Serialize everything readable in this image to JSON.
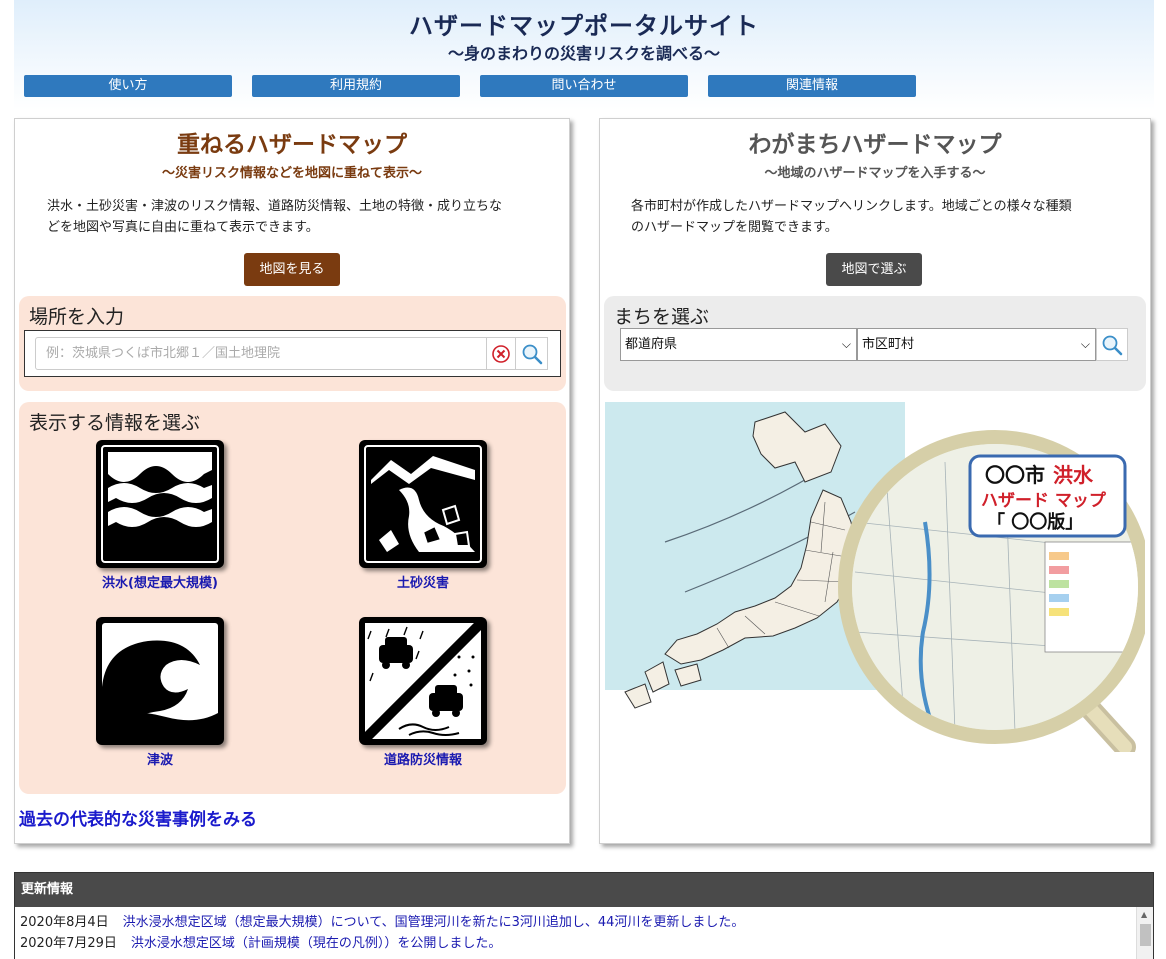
{
  "header": {
    "title": "ハザードマップポータルサイト",
    "subtitle": "～身のまわりの災害リスクを調べる～"
  },
  "nav": [
    {
      "label": "使い方"
    },
    {
      "label": "利用規約"
    },
    {
      "label": "問い合わせ"
    },
    {
      "label": "関連情報"
    }
  ],
  "left_panel": {
    "title": "重ねるハザードマップ",
    "subtitle": "～災害リスク情報などを地図に重ねて表示～",
    "description_line1": "洪水・土砂災害・津波のリスク情報、道路防災情報、土地の特徴・成り立ちな",
    "description_line2": "どを地図や写真に自由に重ねて表示できます。",
    "button_label": "地図を見る",
    "location_box": {
      "title": "場所を入力",
      "placeholder": "例：茨城県つくば市北郷１／国土地理院"
    },
    "info_box": {
      "title": "表示する情報を選ぶ",
      "items": [
        {
          "label": "洪水(想定最大規模)",
          "icon": "flood-icon"
        },
        {
          "label": "土砂災害",
          "icon": "landslide-icon"
        },
        {
          "label": "津波",
          "icon": "tsunami-icon"
        },
        {
          "label": "道路防災情報",
          "icon": "road-disaster-icon"
        }
      ]
    },
    "past_link": "過去の代表的な災害事例をみる"
  },
  "right_panel": {
    "title": "わがまちハザードマップ",
    "subtitle": "～地域のハザードマップを入手する～",
    "description_line1": "各市町村が作成したハザードマップへリンクします。地域ごとの様々な種類",
    "description_line2": "のハザードマップを閲覧できます。",
    "button_label": "地図で選ぶ",
    "town_box": {
      "title": "まちを選ぶ",
      "prefecture_value": "都道府県",
      "city_value": "市区町村"
    },
    "illustration": {
      "sign_line1": "〇〇市",
      "sign_line1_red": "洪水",
      "sign_line2": "ハザード マップ",
      "sign_line3": "「 〇〇版」"
    }
  },
  "updates": {
    "title": "更新情報",
    "rows": [
      {
        "date": "2020年8月4日",
        "text": "洪水浸水想定区域（想定最大規模）について、国管理河川を新たに3河川追加し、44河川を更新しました。"
      },
      {
        "date": "2020年7月29日",
        "text": "洪水浸水想定区域（計画規模（現在の凡例））を公開しました。"
      }
    ]
  },
  "colors": {
    "nav_blue": "#2f79be",
    "left_accent_brown": "#7a3b10",
    "right_title_gray": "#555555",
    "left_box_bg": "#fce4d8",
    "right_box_bg": "#ececec",
    "link_blue": "#1a1ab0",
    "updates_head_bg": "#4a4a4a"
  }
}
